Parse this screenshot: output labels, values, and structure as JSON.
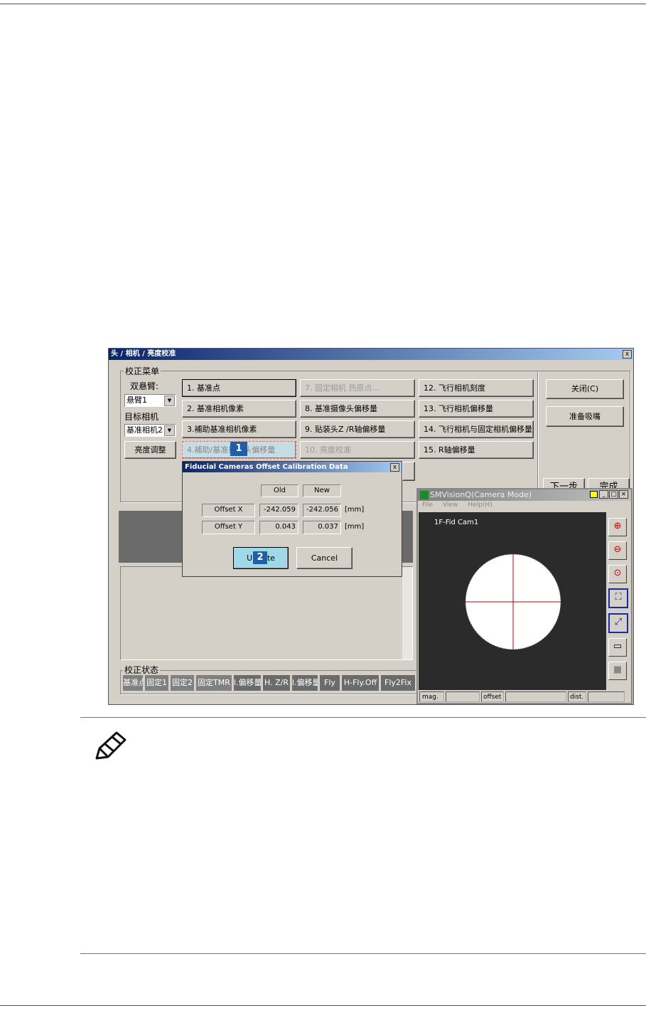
{
  "main_dialog": {
    "title": "头 / 相机 / 亮度校准",
    "close_icon": "x",
    "menu_group": "校正菜单",
    "dual_arm_label": "双悬臂:",
    "dual_arm_value": "悬臂1",
    "target_camera_label": "目标相机",
    "target_camera_value": "基准相机2",
    "brightness_button": "亮度调整",
    "buttons": [
      {
        "label": "1. 基准点",
        "enabled": true
      },
      {
        "label": "2. 基准相机像素",
        "enabled": true
      },
      {
        "label": "3.補助基准相机像素",
        "enabled": true
      },
      {
        "label": "4.補助/基准摄像头偏移量",
        "enabled": true
      },
      {
        "label": "7. 固定相机 热原点…",
        "enabled": false
      },
      {
        "label": "8. 基准摄像头偏移量",
        "enabled": true
      },
      {
        "label": "9. 贴装头Z /R轴偏移量",
        "enabled": true
      },
      {
        "label": "10. 亮度校准",
        "enabled": false
      },
      {
        "label": "12. 飞行相机刻度",
        "enabled": true
      },
      {
        "label": "13. 飞行相机偏移量",
        "enabled": true
      },
      {
        "label": "14. 飞行相机与固定相机偏移量",
        "enabled": true
      },
      {
        "label": "15. R轴偏移量",
        "enabled": true
      }
    ],
    "close_button": "关闭(C)",
    "prepare_nozzle_button": "准备吸嘴",
    "next_button": "下一步",
    "finish_button": "完成",
    "status_group": "校正状态",
    "status_cells": [
      "基准点",
      "固定1",
      "固定2",
      "固定TMR",
      "l.偏移量",
      "H. Z/R",
      "l.偏移量",
      "Fly",
      "H-Fly.Off",
      "Fly2Fix"
    ]
  },
  "offset_dialog": {
    "title": "Fiducial Cameras Offset Calibration Data",
    "close_icon": "x",
    "col_old": "Old",
    "col_new": "New",
    "rows": [
      {
        "label": "Offset X",
        "old": "-242.059",
        "new": "-242.056",
        "unit": "[mm]"
      },
      {
        "label": "Offset Y",
        "old": "0.043",
        "new": "0.037",
        "unit": "[mm]"
      }
    ],
    "update_button": "Update",
    "cancel_button": "Cancel"
  },
  "camera_window": {
    "title": "SMVisionQ(Camera Mode)",
    "menu": [
      "File",
      "View",
      "Help(H)"
    ],
    "camera_label": "1F-Fid Cam1",
    "tools": [
      "zoom-in-icon",
      "zoom-out-icon",
      "zoom-1x-icon",
      "fit-icon",
      "expand-icon",
      "window-icon",
      "stop-icon"
    ],
    "status": [
      "mag.",
      "offset",
      "dist."
    ]
  },
  "callouts": [
    "1",
    "2"
  ],
  "colors": {
    "title_bar": "#0a246a",
    "callout": "#1e5fa8",
    "highlight": "#9fd9e8",
    "rule": "#3a4f8f"
  }
}
